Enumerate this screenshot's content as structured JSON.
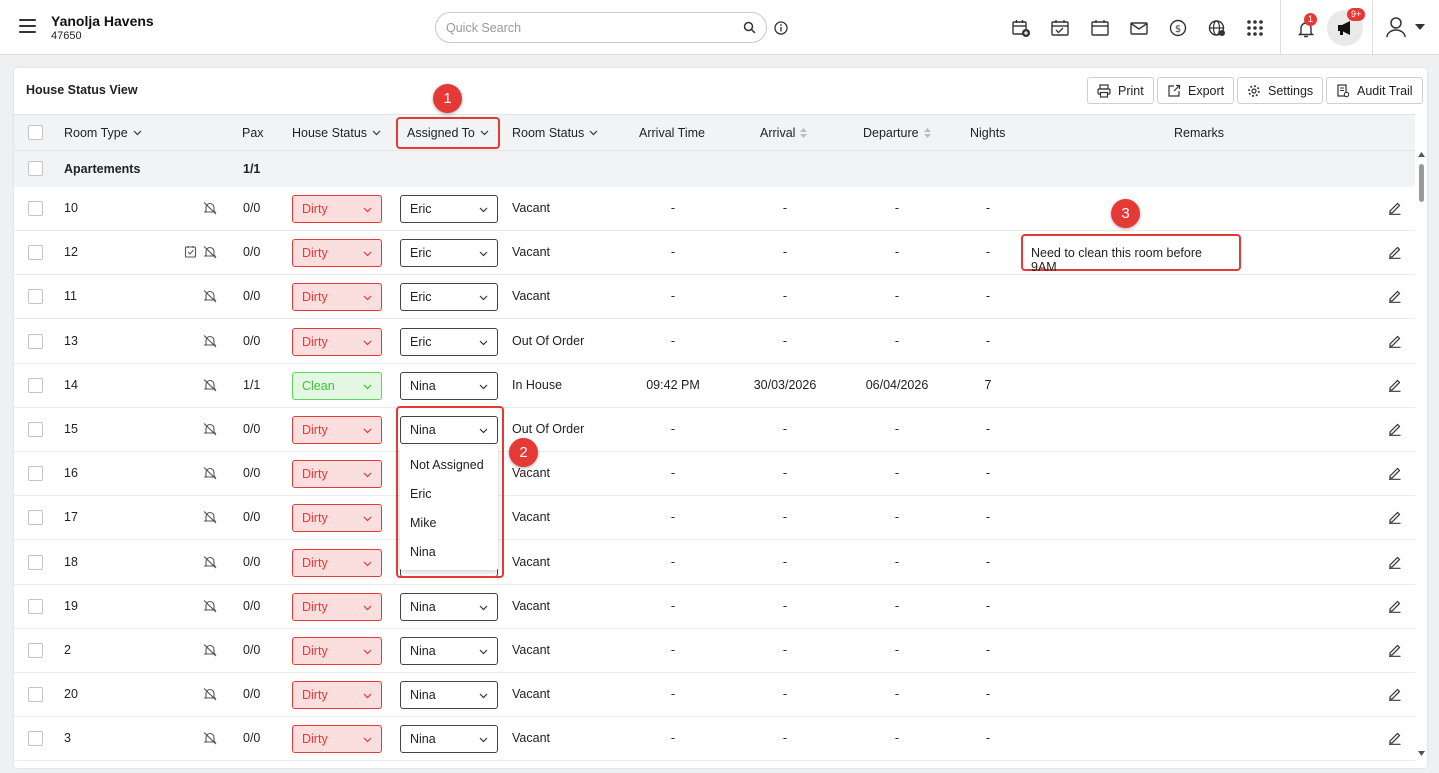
{
  "app": {
    "property_name": "Yanolja Havens",
    "property_id": "47650",
    "search_placeholder": "Quick Search",
    "notification_count": "1",
    "announcement_count": "9+"
  },
  "view": {
    "title": "House Status View",
    "toolbar": {
      "print": "Print",
      "export": "Export",
      "settings": "Settings",
      "audit_trail": "Audit Trail"
    }
  },
  "columns": {
    "room_type": "Room Type",
    "pax": "Pax",
    "house_status": "House Status",
    "assigned_to": "Assigned To",
    "room_status": "Room Status",
    "arrival_time": "Arrival Time",
    "arrival": "Arrival",
    "departure": "Departure",
    "nights": "Nights",
    "remarks": "Remarks"
  },
  "group": {
    "name": "Apartements",
    "pax": "1/1"
  },
  "rows": [
    {
      "room": "10",
      "pax": "0/0",
      "house_status": "Dirty",
      "assigned_to": "Eric",
      "room_status": "Vacant",
      "arrival_time": "-",
      "arrival": "-",
      "departure": "-",
      "nights": "-",
      "remarks": ""
    },
    {
      "room": "12",
      "pax": "0/0",
      "house_status": "Dirty",
      "assigned_to": "Eric",
      "room_status": "Vacant",
      "arrival_time": "-",
      "arrival": "-",
      "departure": "-",
      "nights": "-",
      "remarks": "Need to clean this room before 9AM"
    },
    {
      "room": "11",
      "pax": "0/0",
      "house_status": "Dirty",
      "assigned_to": "Eric",
      "room_status": "Vacant",
      "arrival_time": "-",
      "arrival": "-",
      "departure": "-",
      "nights": "-",
      "remarks": ""
    },
    {
      "room": "13",
      "pax": "0/0",
      "house_status": "Dirty",
      "assigned_to": "Eric",
      "room_status": "Out Of Order",
      "arrival_time": "-",
      "arrival": "-",
      "departure": "-",
      "nights": "-",
      "remarks": ""
    },
    {
      "room": "14",
      "pax": "1/1",
      "house_status": "Clean",
      "assigned_to": "Nina",
      "room_status": "In House",
      "arrival_time": "09:42 PM",
      "arrival": "30/03/2026",
      "departure": "06/04/2026",
      "nights": "7",
      "remarks": ""
    },
    {
      "room": "15",
      "pax": "0/0",
      "house_status": "Dirty",
      "assigned_to": "Nina",
      "room_status": "Out Of Order",
      "arrival_time": "-",
      "arrival": "-",
      "departure": "-",
      "nights": "-",
      "remarks": ""
    },
    {
      "room": "16",
      "pax": "0/0",
      "house_status": "Dirty",
      "assigned_to": "",
      "room_status": "Vacant",
      "arrival_time": "-",
      "arrival": "-",
      "departure": "-",
      "nights": "-",
      "remarks": ""
    },
    {
      "room": "17",
      "pax": "0/0",
      "house_status": "Dirty",
      "assigned_to": "",
      "room_status": "Vacant",
      "arrival_time": "-",
      "arrival": "-",
      "departure": "-",
      "nights": "-",
      "remarks": ""
    },
    {
      "room": "18",
      "pax": "0/0",
      "house_status": "Dirty",
      "assigned_to": "",
      "room_status": "Vacant",
      "arrival_time": "-",
      "arrival": "-",
      "departure": "-",
      "nights": "-",
      "remarks": ""
    },
    {
      "room": "19",
      "pax": "0/0",
      "house_status": "Dirty",
      "assigned_to": "Nina",
      "room_status": "Vacant",
      "arrival_time": "-",
      "arrival": "-",
      "departure": "-",
      "nights": "-",
      "remarks": ""
    },
    {
      "room": "2",
      "pax": "0/0",
      "house_status": "Dirty",
      "assigned_to": "Nina",
      "room_status": "Vacant",
      "arrival_time": "-",
      "arrival": "-",
      "departure": "-",
      "nights": "-",
      "remarks": ""
    },
    {
      "room": "20",
      "pax": "0/0",
      "house_status": "Dirty",
      "assigned_to": "Nina",
      "room_status": "Vacant",
      "arrival_time": "-",
      "arrival": "-",
      "departure": "-",
      "nights": "-",
      "remarks": ""
    },
    {
      "room": "3",
      "pax": "0/0",
      "house_status": "Dirty",
      "assigned_to": "Nina",
      "room_status": "Vacant",
      "arrival_time": "-",
      "arrival": "-",
      "departure": "-",
      "nights": "-",
      "remarks": ""
    }
  ],
  "assign_dropdown": {
    "options": [
      "Not Assigned",
      "Eric",
      "Mike",
      "Nina"
    ]
  },
  "annotations": [
    "1",
    "2",
    "3"
  ],
  "colors": {
    "dirty": "#e53935",
    "clean": "#3cc43c",
    "annotation": "#e53935"
  }
}
